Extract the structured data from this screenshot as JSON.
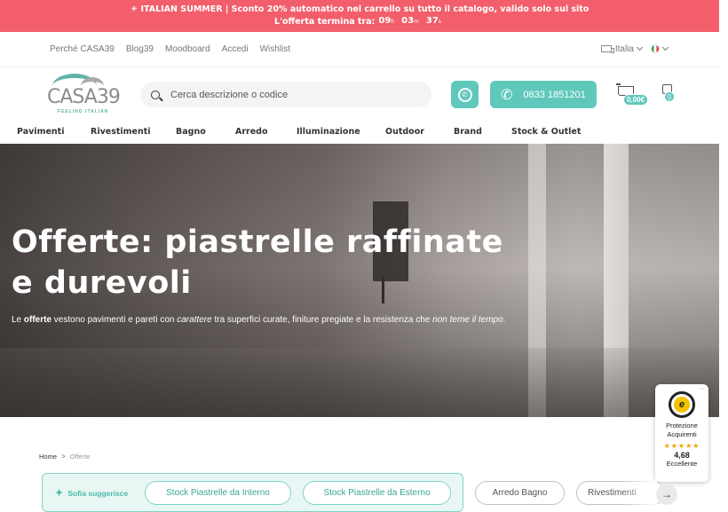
{
  "promo": {
    "line1": "☀ ITALIAN SUMMER | Sconto 20% automatico nel carrello su tutto il catalogo, valido solo sul sito",
    "line2_label": "L'offerta termina tra:",
    "countdown": [
      {
        "value": "09",
        "unit": "h"
      },
      {
        "value": "03",
        "unit": "m"
      },
      {
        "value": "37",
        "unit": "s"
      }
    ]
  },
  "toplinks": {
    "items": [
      "Perché CASA39",
      "Blog39",
      "Moodboard",
      "Accedi",
      "Wishlist"
    ],
    "country": "Italia"
  },
  "header": {
    "logo_word": "CASA39",
    "logo_tag": "FEELING ITALIAN",
    "search_placeholder": "Cerca descrizione o codice",
    "phone": "0833 1851201",
    "cart_total": "0,00€",
    "wishlist_count": "0"
  },
  "nav": {
    "items": [
      "Pavimenti",
      "Rivestimenti",
      "Bagno",
      "Arredo",
      "Illuminazione",
      "Outdoor",
      "Brand",
      "Stock & Outlet"
    ]
  },
  "hero": {
    "title_line1": "Offerte: piastrelle raffinate",
    "title_line2": "e durevoli",
    "sub": {
      "p1": "Le ",
      "b1": "offerte",
      "p2": " vestono pavimenti e pareti con ",
      "i1": "carattere",
      "p3": " tra superfici curate, finiture pregiate e la resistenza che ",
      "i2": "non teme il tempo",
      "p4": "."
    }
  },
  "trust": {
    "dots": "···",
    "seal": "e",
    "label1": "Protezione",
    "label2": "Acquirenti",
    "stars": "★★★★★",
    "score": "4,68",
    "rating": "Eccellente"
  },
  "breadcrumb": {
    "home": "Home",
    "sep": ">",
    "current": "Offerte"
  },
  "suggestions": {
    "label": "Sofia suggerisce",
    "chips": [
      "Stock Piastrelle da Interno",
      "Stock Piastrelle da Esterno"
    ],
    "other_chips": [
      "Arredo Bagno",
      "Rivestimenti"
    ]
  },
  "colors": {
    "promo_bg": "#f25e6b",
    "accent": "#5fc8bb"
  }
}
